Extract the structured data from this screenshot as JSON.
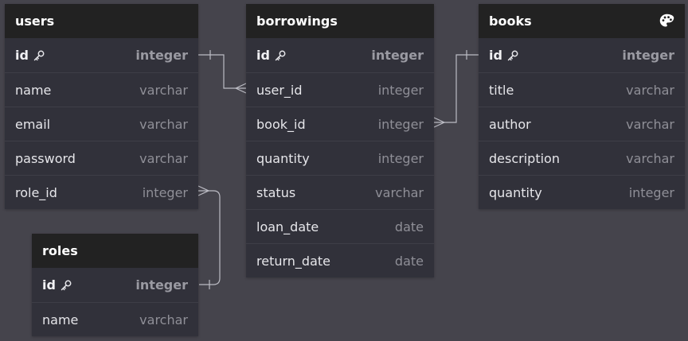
{
  "tables": {
    "users": {
      "title": "users",
      "columns": [
        {
          "name": "id",
          "type": "integer",
          "pk": true
        },
        {
          "name": "name",
          "type": "varchar"
        },
        {
          "name": "email",
          "type": "varchar"
        },
        {
          "name": "password",
          "type": "varchar"
        },
        {
          "name": "role_id",
          "type": "integer"
        }
      ]
    },
    "borrowings": {
      "title": "borrowings",
      "columns": [
        {
          "name": "id",
          "type": "integer",
          "pk": true
        },
        {
          "name": "user_id",
          "type": "integer"
        },
        {
          "name": "book_id",
          "type": "integer"
        },
        {
          "name": "quantity",
          "type": "integer"
        },
        {
          "name": "status",
          "type": "varchar"
        },
        {
          "name": "loan_date",
          "type": "date"
        },
        {
          "name": "return_date",
          "type": "date"
        }
      ]
    },
    "books": {
      "title": "books",
      "header_icon": "palette-icon",
      "columns": [
        {
          "name": "id",
          "type": "integer",
          "pk": true
        },
        {
          "name": "title",
          "type": "varchar"
        },
        {
          "name": "author",
          "type": "varchar"
        },
        {
          "name": "description",
          "type": "varchar"
        },
        {
          "name": "quantity",
          "type": "integer"
        }
      ]
    },
    "roles": {
      "title": "roles",
      "columns": [
        {
          "name": "id",
          "type": "integer",
          "pk": true
        },
        {
          "name": "name",
          "type": "varchar"
        }
      ]
    }
  },
  "relations": [
    {
      "from": "users.id",
      "to": "borrowings.user_id",
      "type": "one-to-many"
    },
    {
      "from": "books.id",
      "to": "borrowings.book_id",
      "type": "one-to-many"
    },
    {
      "from": "roles.id",
      "to": "users.role_id",
      "type": "one-to-many"
    }
  ],
  "colors": {
    "background": "#45444c",
    "table_body": "#31313a",
    "table_header": "#222222",
    "connector": "#bcbcc4"
  }
}
